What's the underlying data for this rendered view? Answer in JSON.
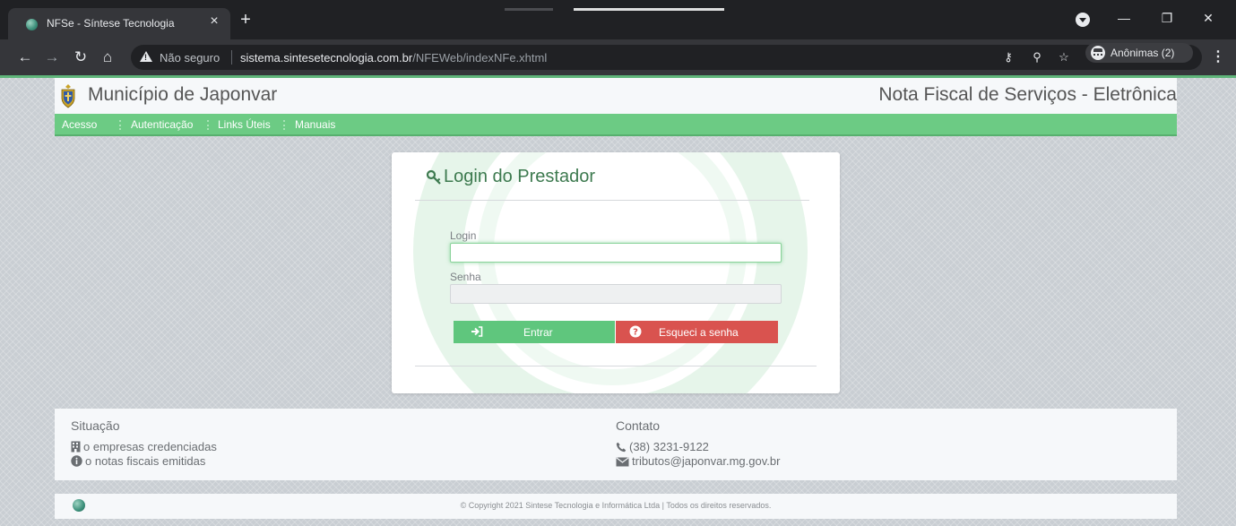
{
  "browser": {
    "tab_title": "NFSe - Síntese Tecnologia",
    "tab_close": "×",
    "new_tab": "+",
    "not_secure": "Não seguro",
    "url_host": "sistema.sintesetecnologia.com.br",
    "url_path": "/NFEWeb/indexNFe.xhtml",
    "profile_label": "Anônimas (2)",
    "minimize": "—",
    "restore": "❐",
    "close": "✕"
  },
  "header": {
    "site_title": "Município de Japonvar",
    "system_title": "Nota Fiscal de Serviços - Eletrônica"
  },
  "menu": {
    "items": [
      "Acesso",
      "Autenticação",
      "Links Úteis",
      "Manuais"
    ]
  },
  "login": {
    "title": "Login do Prestador",
    "login_label": "Login",
    "login_value": "",
    "password_label": "Senha",
    "password_value": "",
    "submit_label": "Entrar",
    "forgot_label": "Esqueci a senha"
  },
  "situacao": {
    "heading": "Situação",
    "empresas": "o empresas credenciadas",
    "notas": "o notas fiscais emitidas"
  },
  "contato": {
    "heading": "Contato",
    "phone": "(38) 3231-9122",
    "email": "tributos@japonvar.mg.gov.br"
  },
  "footer": {
    "copyright": "© Copyright 2021 Sintese Tecnologia e Informática Ltda | Todos os direitos reservados."
  },
  "colors": {
    "accent_green": "#6ccb84",
    "danger_red": "#d9534f",
    "title_green": "#3d7a4f"
  }
}
